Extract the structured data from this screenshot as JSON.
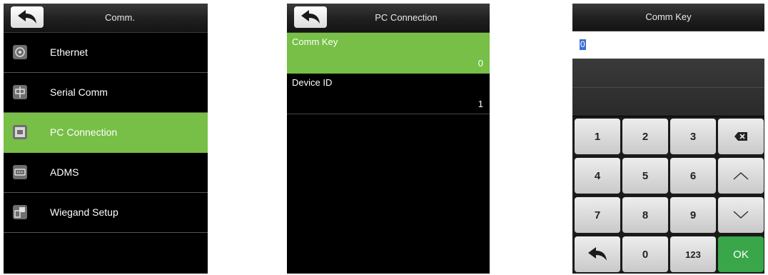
{
  "screen1": {
    "title": "Comm.",
    "items": [
      {
        "label": "Ethernet",
        "icon": "ethernet-icon"
      },
      {
        "label": "Serial Comm",
        "icon": "serial-comm-icon"
      },
      {
        "label": "PC Connection",
        "icon": "pc-connection-icon",
        "selected": true
      },
      {
        "label": "ADMS",
        "icon": "adms-icon"
      },
      {
        "label": "Wiegand Setup",
        "icon": "wiegand-icon"
      }
    ]
  },
  "screen2": {
    "title": "PC Connection",
    "fields": [
      {
        "label": "Comm Key",
        "value": "0",
        "selected": true
      },
      {
        "label": "Device ID",
        "value": "1"
      }
    ]
  },
  "screen3": {
    "title": "Comm Key",
    "value": "0",
    "keys": {
      "k1": "1",
      "k2": "2",
      "k3": "3",
      "k4": "4",
      "k5": "5",
      "k6": "6",
      "k7": "7",
      "k8": "8",
      "k9": "9",
      "k0": "0",
      "mode": "123",
      "ok": "OK"
    }
  },
  "colors": {
    "accent": "#77bf46",
    "ok": "#3aa64a",
    "selection": "#3a6fd8"
  }
}
